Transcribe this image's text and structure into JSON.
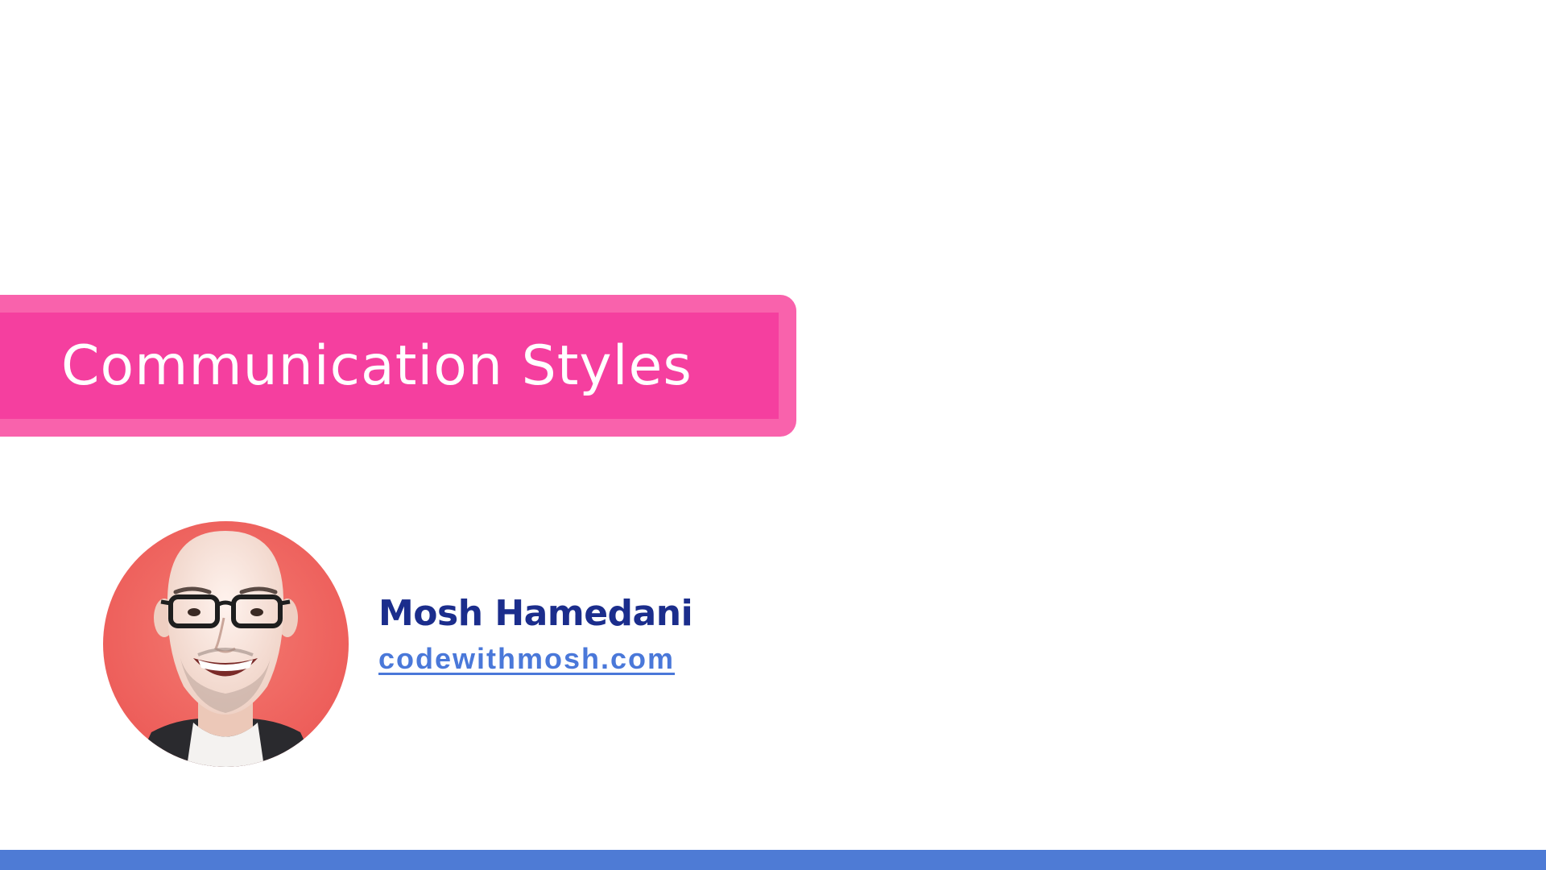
{
  "title": {
    "text": "Communication Styles"
  },
  "presenter": {
    "name": "Mosh Hamedani",
    "website": "codewithmosh.com"
  },
  "colors": {
    "banner_outer": "#f962ac",
    "banner_inner": "#f53f9f",
    "name_text": "#1b2d8c",
    "link_text": "#4a78d9",
    "bottom_bar": "#4e7bd5",
    "avatar_background": "#f0625f"
  }
}
